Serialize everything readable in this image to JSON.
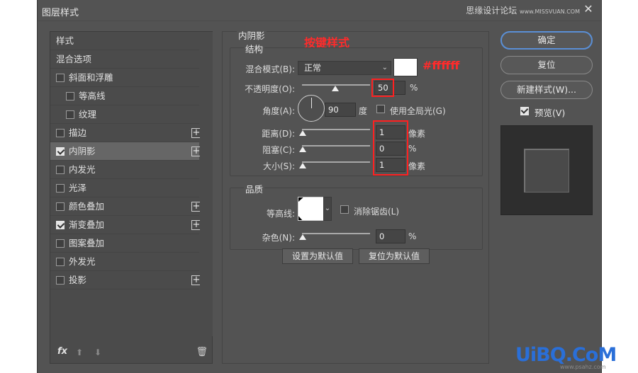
{
  "window": {
    "title": "图层样式",
    "watermark_top": "思缘设计论坛",
    "watermark_top_url": "www.MISSVUAN.COM",
    "close_symbol": "✕"
  },
  "left_list": {
    "items": [
      {
        "label": "样式",
        "type": "header"
      },
      {
        "label": "混合选项",
        "type": "header"
      },
      {
        "label": "斜面和浮雕",
        "checked": false,
        "indent": 0
      },
      {
        "label": "等高线",
        "checked": false,
        "indent": 1
      },
      {
        "label": "纹理",
        "checked": false,
        "indent": 1
      },
      {
        "label": "描边",
        "checked": false,
        "plus": true
      },
      {
        "label": "内阴影",
        "checked": true,
        "plus": true,
        "selected": true
      },
      {
        "label": "内发光",
        "checked": false
      },
      {
        "label": "光泽",
        "checked": false
      },
      {
        "label": "颜色叠加",
        "checked": false,
        "plus": true
      },
      {
        "label": "渐变叠加",
        "checked": true,
        "plus": true
      },
      {
        "label": "图案叠加",
        "checked": false
      },
      {
        "label": "外发光",
        "checked": false
      },
      {
        "label": "投影",
        "checked": false,
        "plus": true
      }
    ],
    "plus_symbol": "+",
    "fx_label": "fx",
    "up_symbol": "⬆",
    "down_symbol": "⬇",
    "trash_symbol": "🗑"
  },
  "center": {
    "section_title": "内阴影",
    "annotation_title": "按键样式",
    "structure": {
      "title": "结构",
      "blend_mode_label": "混合模式(B):",
      "blend_mode_value": "正常",
      "color_annotation": "#ffffff",
      "opacity_label": "不透明度(O):",
      "opacity_value": "50",
      "opacity_unit": "%",
      "angle_label": "角度(A):",
      "angle_value": "90",
      "angle_unit": "度",
      "global_light_label": "使用全局光(G)",
      "distance_label": "距离(D):",
      "distance_value": "1",
      "distance_unit": "像素",
      "choke_label": "阻塞(C):",
      "choke_value": "0",
      "choke_unit": "%",
      "size_label": "大小(S):",
      "size_value": "1",
      "size_unit": "像素"
    },
    "quality": {
      "title": "品质",
      "contour_label": "等高线:",
      "anti_alias_label": "消除锯齿(L)",
      "noise_label": "杂色(N):",
      "noise_value": "0",
      "noise_unit": "%"
    },
    "set_default_label": "设置为默认值",
    "reset_default_label": "复位为默认值"
  },
  "right": {
    "ok_label": "确定",
    "reset_label": "复位",
    "new_style_label": "新建样式(W)...",
    "preview_label": "预览(V)"
  },
  "brand": {
    "logo": "UiBQ.CoM",
    "sub": "www.psahz.com"
  }
}
